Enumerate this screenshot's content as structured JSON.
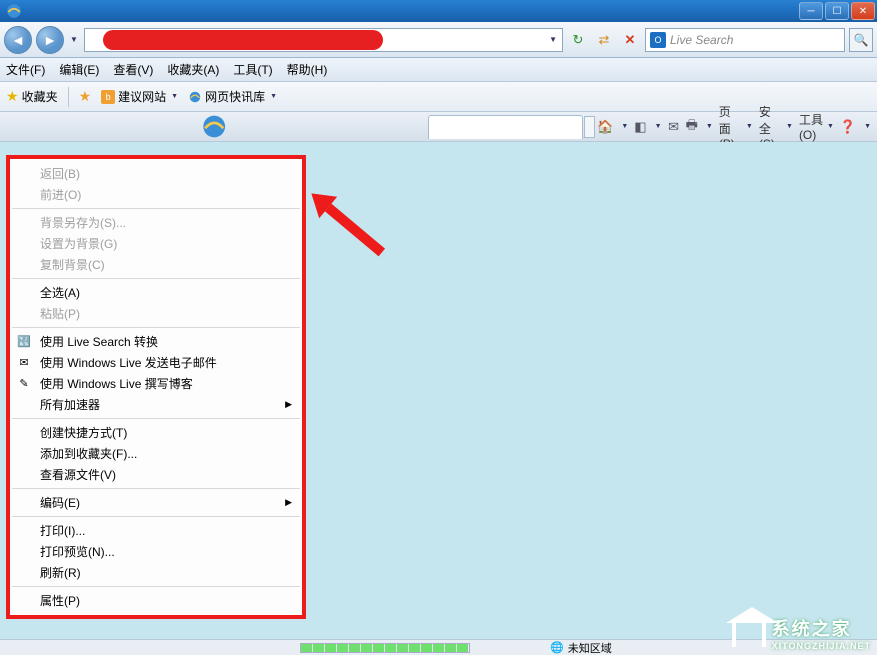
{
  "menubar": {
    "file": "文件(F)",
    "edit": "编辑(E)",
    "view": "查看(V)",
    "favorites": "收藏夹(A)",
    "tools": "工具(T)",
    "help": "帮助(H)"
  },
  "favbar": {
    "label": "收藏夹",
    "suggest": "建议网站",
    "feed": "网页快讯库"
  },
  "cmdbar": {
    "page": "页面(P)",
    "safety": "安全(S)",
    "tools": "工具(O)"
  },
  "search": {
    "placeholder": "Live Search"
  },
  "ctx": {
    "back": "返回(B)",
    "forward": "前进(O)",
    "savebg": "背景另存为(S)...",
    "setbg": "设置为背景(G)",
    "copybg": "复制背景(C)",
    "selectall": "全选(A)",
    "paste": "粘贴(P)",
    "liveconv": "使用 Live Search 转换",
    "livemail": "使用 Windows Live 发送电子邮件",
    "liveblog": "使用 Windows Live 撰写博客",
    "accel": "所有加速器",
    "shortcut": "创建快捷方式(T)",
    "addfav": "添加到收藏夹(F)...",
    "viewsrc": "查看源文件(V)",
    "encoding": "编码(E)",
    "print": "打印(I)...",
    "printpre": "打印预览(N)...",
    "refresh": "刷新(R)",
    "props": "属性(P)"
  },
  "status": {
    "zone": "未知区域"
  },
  "wm": {
    "name": "系统之家",
    "url": "XITONGZHIJIA.NET"
  }
}
